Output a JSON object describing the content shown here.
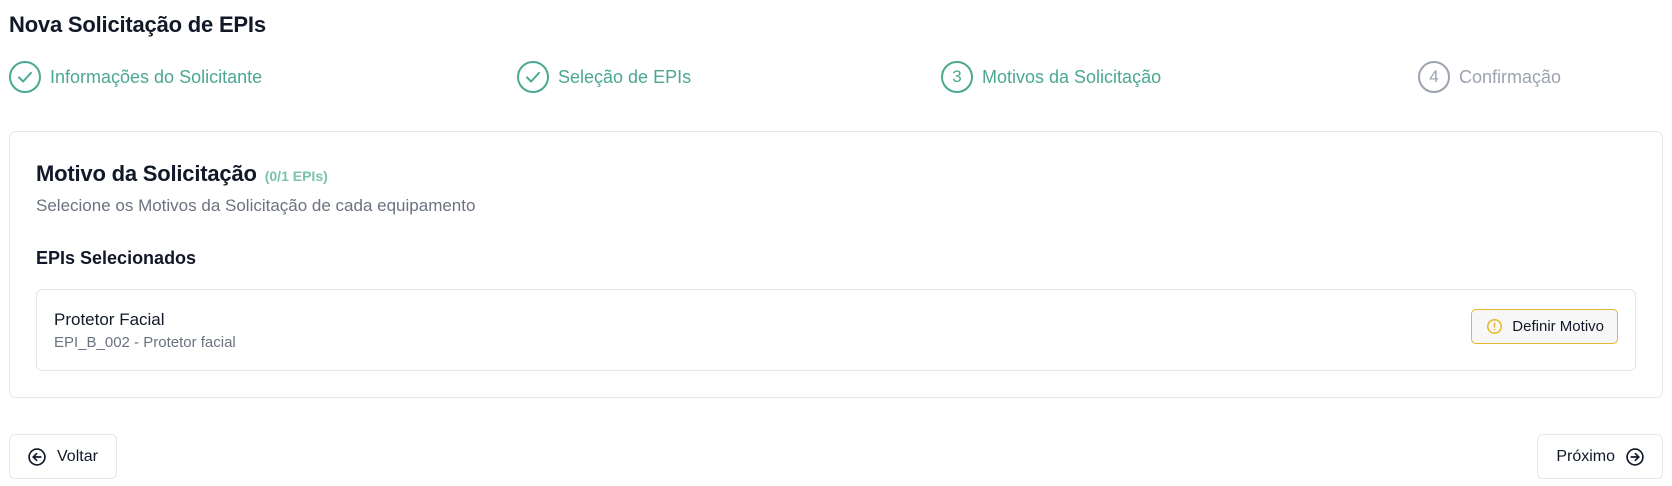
{
  "page": {
    "title": "Nova Solicitação de EPIs"
  },
  "stepper": {
    "steps": [
      {
        "label": "Informações do Solicitante",
        "status": "completed",
        "icon": "check-icon"
      },
      {
        "label": "Seleção de EPIs",
        "status": "completed",
        "icon": "check-icon"
      },
      {
        "label": "Motivos da Solicitação",
        "status": "current",
        "number": "3"
      },
      {
        "label": "Confirmação",
        "status": "upcoming",
        "number": "4"
      }
    ]
  },
  "card": {
    "title": "Motivo da Solicitação",
    "count": "(0/1 EPIs)",
    "description": "Selecione os Motivos da Solicitação de cada equipamento",
    "section_title": "EPIs Selecionados",
    "items": [
      {
        "name": "Protetor Facial",
        "code": "EPI_B_002 - Protetor facial",
        "action_label": "Definir Motivo",
        "action_icon": "alert-circle-icon"
      }
    ]
  },
  "footer": {
    "back_label": "Voltar",
    "back_icon": "arrow-left-circle-icon",
    "next_label": "Próximo",
    "next_icon": "arrow-right-circle-icon"
  },
  "colors": {
    "accent": "#4aa891",
    "accent_light": "#79c3ab",
    "inactive": "#9ca3af",
    "warning_border": "#e4b72e",
    "text": "#111827",
    "muted": "#6b7280",
    "border": "#e5e7eb"
  }
}
